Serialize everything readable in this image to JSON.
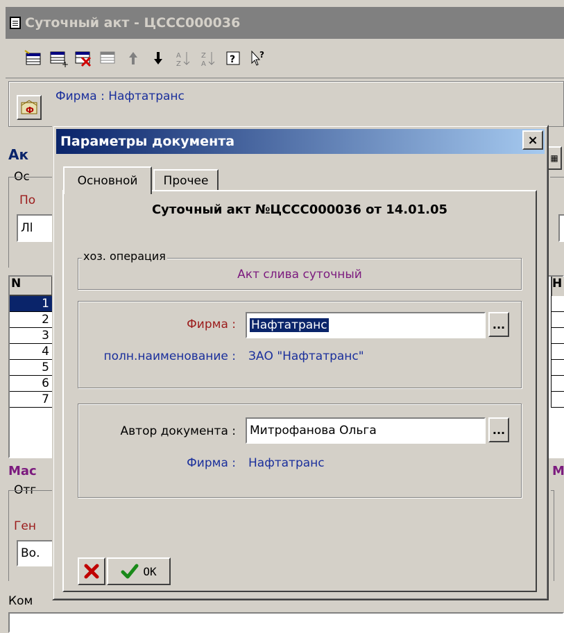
{
  "window": {
    "title": "Суточный акт - ЦССС000036",
    "toolbar_icons": [
      "new-row-icon",
      "insert-row-icon",
      "delete-row-icon",
      "copy-row-icon",
      "arrow-up-icon",
      "arrow-down-icon",
      "sort-asc-icon",
      "sort-desc-icon",
      "help-icon",
      "whats-this-icon"
    ]
  },
  "header": {
    "firm_line": "Фирма : Нафтатранс"
  },
  "background": {
    "act_label_fragment": "Ак",
    "group_fragment": "Ос",
    "field_label_fragment": "По",
    "field_value_fragment": "Лl",
    "table_header_n": "N",
    "table_header_right": "Н",
    "row_numbers": [
      "1",
      "2",
      "3",
      "4",
      "5",
      "6",
      "7"
    ],
    "mass_fragment": "Мас",
    "mass_right_fragment": "М",
    "otp_fragment": "Отг",
    "gen_fragment": "Ген",
    "vo_fragment": "Во.",
    "comment_fragment": "Ком"
  },
  "dialog": {
    "title": "Параметры документа",
    "close_symbol": "×",
    "tabs": [
      {
        "label": "Основной",
        "active": true
      },
      {
        "label": "Прочее",
        "active": false
      }
    ],
    "heading": "Суточный акт №ЦССС000036 от 14.01.05",
    "operation_group_label": "хоз. операция",
    "operation_value": "Акт слива суточный",
    "firm_label": "Фирма :",
    "firm_value": "Нафтатранс",
    "full_name_label": "полн.наименование :",
    "full_name_value": "ЗАО \"Нафтатранс\"",
    "author_label": "Автор документа :",
    "author_value": "Митрофанова Ольга",
    "author_firm_label": "Фирма :",
    "author_firm_value": "Нафтатранс",
    "ellipsis": "...",
    "ok_label": "OK"
  },
  "colors": {
    "title_active": "#0a246a",
    "selection": "#0a246a",
    "label_red": "#9b1b1b",
    "label_blue": "#1a2f9c",
    "label_purple": "#7b1a7e"
  }
}
